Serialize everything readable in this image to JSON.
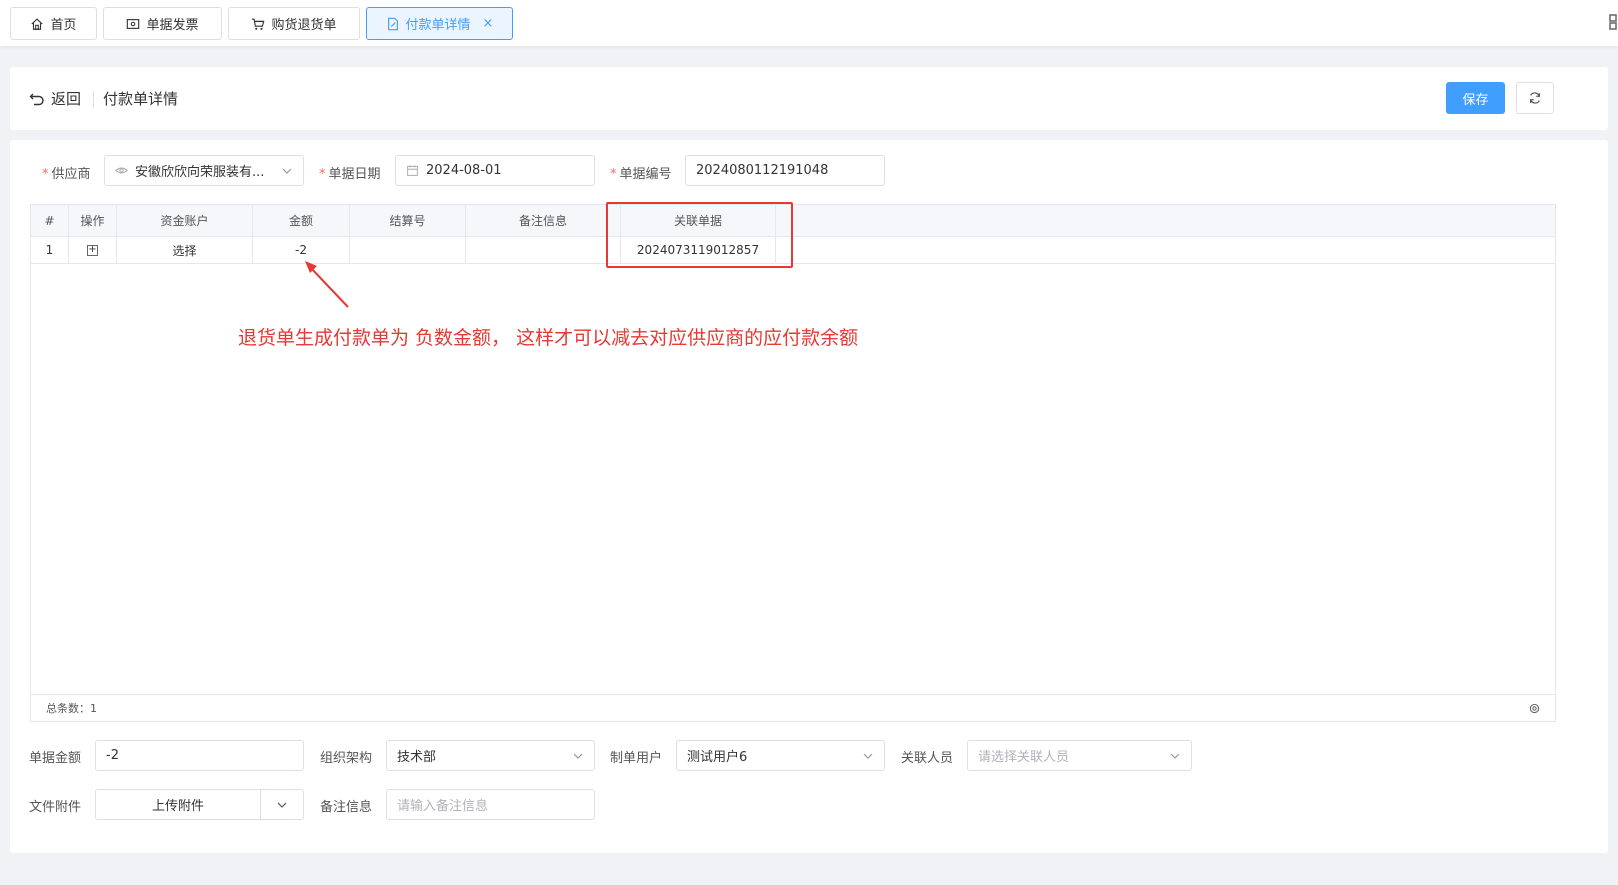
{
  "tabs": [
    {
      "label": "首页",
      "icon": "home-icon"
    },
    {
      "label": "单据发票",
      "icon": "invoice-icon"
    },
    {
      "label": "购货退货单",
      "icon": "cart-icon"
    },
    {
      "label": "付款单详情",
      "icon": "document-edit-icon",
      "active": true,
      "close": "×"
    }
  ],
  "header": {
    "back_label": "返回",
    "title": "付款单详情",
    "save_label": "保存"
  },
  "form_top": {
    "supplier_label": "供应商",
    "supplier_value": "安徽欣欣向荣服装有...",
    "date_label": "单据日期",
    "date_value": "2024-08-01",
    "number_label": "单据编号",
    "number_value": "2024080112191048",
    "required_mark": "*"
  },
  "table": {
    "columns": [
      "#",
      "操作",
      "资金账户",
      "金额",
      "结算号",
      "备注信息",
      "关联单据"
    ],
    "rows": [
      {
        "index": "1",
        "op": "+",
        "account": "选择",
        "amount": "-2",
        "settle_no": "",
        "remark": "",
        "related": "2024073119012857"
      }
    ],
    "footer_total": "总条数：1"
  },
  "annotation": {
    "text": "退货单生成付款单为 负数金额， 这样才可以减去对应供应商的应付款余额",
    "color": "#e53935"
  },
  "form_bottom": {
    "amount_label": "单据金额",
    "amount_value": "-2",
    "org_label": "组织架构",
    "org_value": "技术部",
    "creator_label": "制单用户",
    "creator_value": "测试用户6",
    "related_person_label": "关联人员",
    "related_person_placeholder": "请选择关联人员",
    "attachment_label": "文件附件",
    "upload_label": "上传附件",
    "remark_label": "备注信息",
    "remark_placeholder": "请输入备注信息"
  },
  "colors": {
    "primary": "#409eff",
    "annotation": "#e53935"
  }
}
